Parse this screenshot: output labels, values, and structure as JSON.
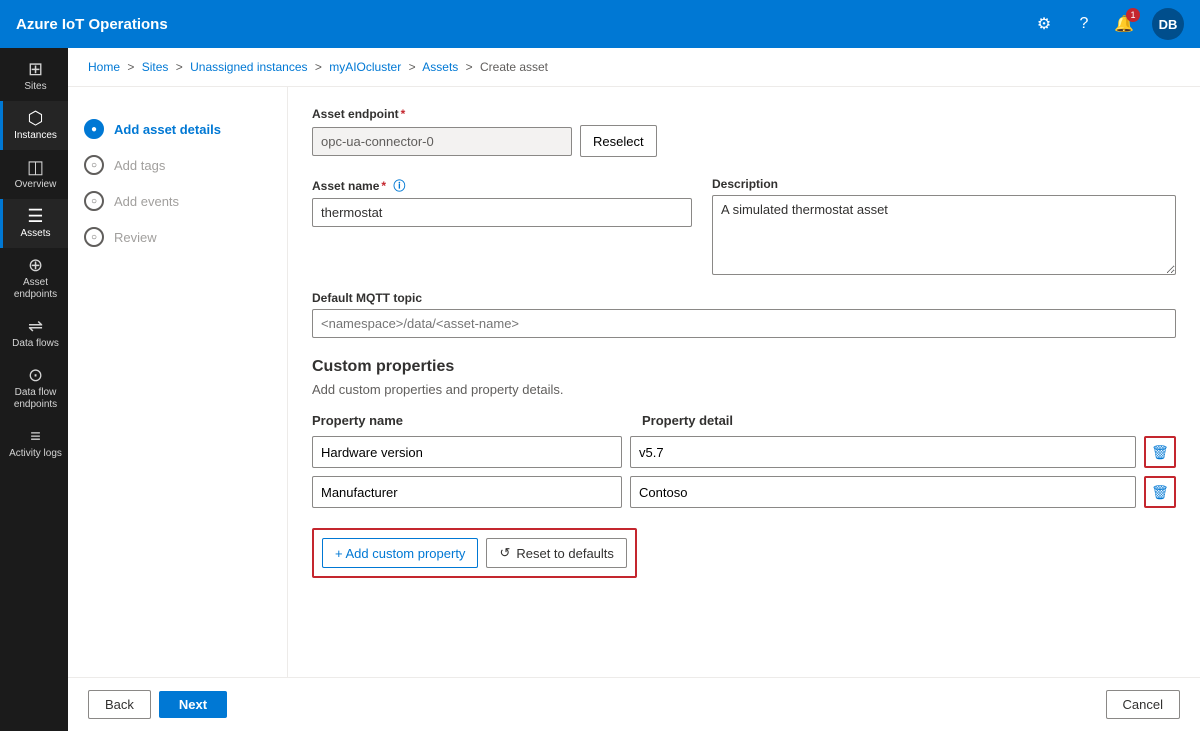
{
  "app": {
    "title": "Azure IoT Operations"
  },
  "topnav": {
    "settings_tooltip": "Settings",
    "help_tooltip": "Help",
    "notifications_tooltip": "Notifications",
    "notification_count": "1",
    "avatar_initials": "DB"
  },
  "sidebar": {
    "items": [
      {
        "id": "sites",
        "label": "Sites",
        "icon": "⊞"
      },
      {
        "id": "instances",
        "label": "Instances",
        "icon": "⬡",
        "active": true
      },
      {
        "id": "overview",
        "label": "Overview",
        "icon": "◫"
      },
      {
        "id": "assets",
        "label": "Assets",
        "icon": "☰",
        "active_line": true
      },
      {
        "id": "asset-endpoints",
        "label": "Asset endpoints",
        "icon": "⊕"
      },
      {
        "id": "data-flows",
        "label": "Data flows",
        "icon": "⇌"
      },
      {
        "id": "data-flow-endpoints",
        "label": "Data flow endpoints",
        "icon": "⊙"
      },
      {
        "id": "activity-logs",
        "label": "Activity logs",
        "icon": "≡"
      }
    ]
  },
  "breadcrumb": {
    "items": [
      {
        "label": "Home",
        "href": "#"
      },
      {
        "label": "Sites",
        "href": "#"
      },
      {
        "label": "Unassigned instances",
        "href": "#"
      },
      {
        "label": "myAIOcluster",
        "href": "#"
      },
      {
        "label": "Assets",
        "href": "#"
      },
      {
        "label": "Create asset",
        "href": null
      }
    ]
  },
  "wizard": {
    "steps": [
      {
        "id": "add-asset-details",
        "label": "Add asset details",
        "state": "active"
      },
      {
        "id": "add-tags",
        "label": "Add tags",
        "state": "inactive"
      },
      {
        "id": "add-events",
        "label": "Add events",
        "state": "inactive"
      },
      {
        "id": "review",
        "label": "Review",
        "state": "inactive"
      }
    ]
  },
  "form": {
    "asset_endpoint_label": "Asset endpoint",
    "asset_endpoint_required": true,
    "asset_endpoint_value": "opc-ua-connector-0",
    "reselect_label": "Reselect",
    "asset_name_label": "Asset name",
    "asset_name_required": true,
    "asset_name_value": "thermostat",
    "description_label": "Description",
    "description_value": "A simulated thermostat asset",
    "mqtt_topic_label": "Default MQTT topic",
    "mqtt_topic_placeholder": "<namespace>/data/<asset-name>",
    "custom_props": {
      "title": "Custom properties",
      "description": "Add custom properties and property details.",
      "col_property_name": "Property name",
      "col_property_detail": "Property detail",
      "properties": [
        {
          "name": "Hardware version",
          "detail": "v5.7"
        },
        {
          "name": "Manufacturer",
          "detail": "Contoso"
        }
      ],
      "add_label": "+ Add custom property",
      "reset_label": "Reset to defaults"
    }
  },
  "footer": {
    "back_label": "Back",
    "next_label": "Next",
    "cancel_label": "Cancel"
  }
}
